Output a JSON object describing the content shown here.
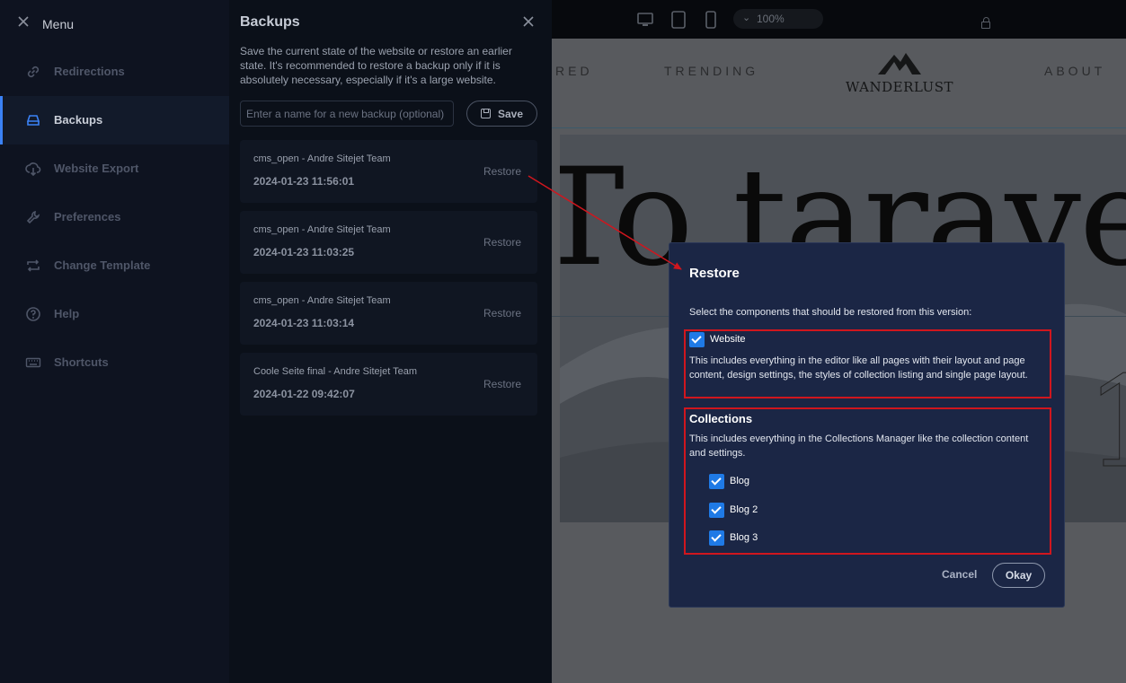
{
  "menu": {
    "title": "Menu",
    "items": [
      {
        "label": "Redirections",
        "icon": "link-icon"
      },
      {
        "label": "Backups",
        "icon": "backup-icon",
        "active": true
      },
      {
        "label": "Website Export",
        "icon": "cloud-download-icon"
      },
      {
        "label": "Preferences",
        "icon": "wrench-icon"
      },
      {
        "label": "Change Template",
        "icon": "swap-icon"
      },
      {
        "label": "Help",
        "icon": "help-icon"
      },
      {
        "label": "Shortcuts",
        "icon": "keyboard-icon"
      }
    ]
  },
  "backups": {
    "title": "Backups",
    "description": "Save the current state of the website or restore an earlier state. It's recommended to restore a backup only if it is absolutely necessary, especially if it's a large website.",
    "name_placeholder": "Enter a name for a new backup (optional)",
    "save_label": "Save",
    "list": [
      {
        "name": "cms_open - Andre Sitejet Team",
        "date": "2024-01-23 11:56:01",
        "action": "Restore"
      },
      {
        "name": "cms_open - Andre Sitejet Team",
        "date": "2024-01-23 11:03:25",
        "action": "Restore"
      },
      {
        "name": "cms_open - Andre Sitejet Team",
        "date": "2024-01-23 11:03:14",
        "action": "Restore"
      },
      {
        "name": "Coole Seite final - Andre Sitejet Team",
        "date": "2024-01-22 09:42:07",
        "action": "Restore"
      }
    ]
  },
  "preview": {
    "zoom": "100%",
    "nav": [
      "RED",
      "TRENDING",
      "ABOUT"
    ],
    "logo_text": "WANDERLUST",
    "hero_text": "To taravel",
    "hero_number": "1"
  },
  "restore_dialog": {
    "title": "Restore",
    "intro": "Select the components that should be restored from this version:",
    "website": {
      "label": "Website",
      "checked": true,
      "description": "This includes everything in the editor like all pages with their layout and page content, design settings, the styles of collection listing and single page layout."
    },
    "collections": {
      "heading": "Collections",
      "description": "This includes everything in the Collections Manager like the collection content and settings.",
      "items": [
        {
          "label": "Blog",
          "checked": true
        },
        {
          "label": "Blog 2",
          "checked": true
        },
        {
          "label": "Blog 3",
          "checked": true
        }
      ]
    },
    "cancel_label": "Cancel",
    "ok_label": "Okay"
  },
  "colors": {
    "accent": "#3b82f6",
    "checkbox": "#1f7ae6",
    "highlight": "#d0161e",
    "dialog_bg": "#1b2645"
  }
}
